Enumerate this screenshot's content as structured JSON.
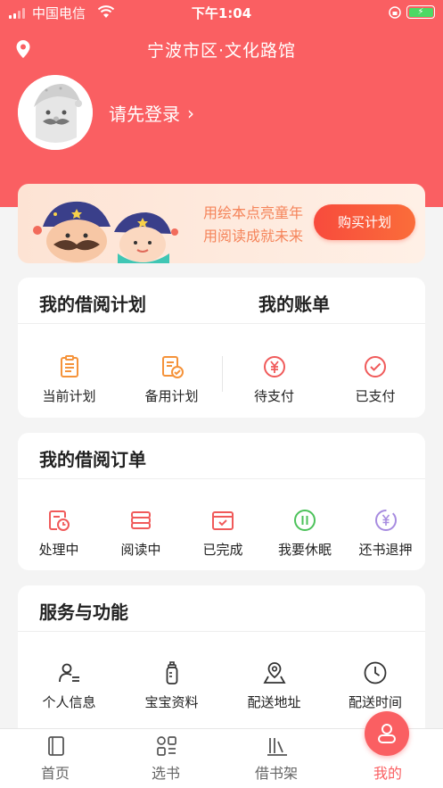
{
  "status_bar": {
    "carrier": "中国电信",
    "time": "下午1:04"
  },
  "header": {
    "location": "宁波市区·文化路馆",
    "login_prompt": "请先登录",
    "login_chevron": "›"
  },
  "banner": {
    "slogan_line1": "用绘本点亮童年",
    "slogan_line2": "用阅读成就未来",
    "buy_button": "购买计划"
  },
  "plan_card": {
    "title_left": "我的借阅计划",
    "title_right": "我的账单",
    "items": [
      {
        "label": "当前计划",
        "icon": "clipboard-list-icon"
      },
      {
        "label": "备用计划",
        "icon": "clipboard-check-icon"
      },
      {
        "label": "待支付",
        "icon": "yen-circle-icon"
      },
      {
        "label": "已支付",
        "icon": "check-circle-icon"
      }
    ]
  },
  "orders_card": {
    "title": "我的借阅订单",
    "items": [
      {
        "label": "处理中",
        "icon": "doc-clock-icon"
      },
      {
        "label": "阅读中",
        "icon": "book-stack-icon"
      },
      {
        "label": "已完成",
        "icon": "calendar-check-icon"
      },
      {
        "label": "我要休眠",
        "icon": "pause-circle-icon"
      },
      {
        "label": "还书退押",
        "icon": "yen-refund-icon"
      }
    ]
  },
  "services_card": {
    "title": "服务与功能",
    "items": [
      {
        "label": "个人信息",
        "icon": "person-list-icon"
      },
      {
        "label": "宝宝资料",
        "icon": "baby-bottle-icon"
      },
      {
        "label": "配送地址",
        "icon": "map-pin-icon"
      },
      {
        "label": "配送时间",
        "icon": "clock-icon"
      }
    ]
  },
  "tabbar": {
    "tabs": [
      {
        "label": "首页",
        "icon": "book-icon"
      },
      {
        "label": "选书",
        "icon": "grid-list-icon"
      },
      {
        "label": "借书架",
        "icon": "bookshelf-icon"
      },
      {
        "label": "我的",
        "icon": "user-icon"
      }
    ],
    "active_index": 3
  },
  "colors": {
    "brand_red": "#fa5f62",
    "orange": "#f5933a",
    "purple": "#a78be0",
    "green": "#4cc25a"
  }
}
